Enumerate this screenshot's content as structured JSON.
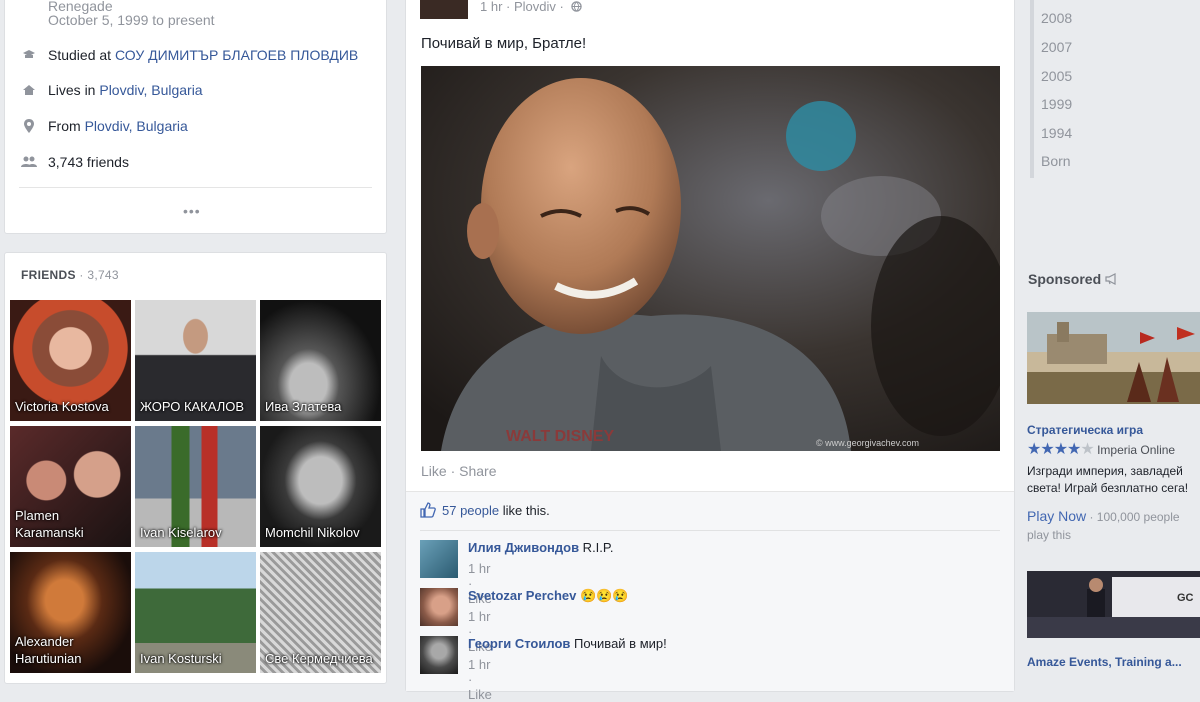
{
  "intro": {
    "top_line": "Renegade",
    "date_line": "October 5, 1999 to present",
    "studied_prefix": "Studied at ",
    "studied_link": "СОУ ДИМИТЪР БЛАГОЕВ ПЛОВДИВ",
    "lives_prefix": "Lives in ",
    "lives_link": "Plovdiv, Bulgaria",
    "from_prefix": "From ",
    "from_link": "Plovdiv, Bulgaria",
    "friends_count": "3,743 friends",
    "more": "•••"
  },
  "friends": {
    "title": "FRIENDS",
    "count": " · 3,743",
    "items": [
      {
        "name": "Victoria Kostova"
      },
      {
        "name": "ЖОРО КАКАЛОВ"
      },
      {
        "name": "Ива Златева"
      },
      {
        "name": "Plamen Karamanski"
      },
      {
        "name": "Ivan Kiselarov"
      },
      {
        "name": "Momchil Nikolov"
      },
      {
        "name": "Alexander Harutiunian"
      },
      {
        "name": "Ivan Kosturski"
      },
      {
        "name": "Све Кермедчиева"
      }
    ]
  },
  "post": {
    "meta": "1 hr · Plovdiv · ",
    "globe_icon": "globe-icon",
    "text": "Почивай в мир, Братле!",
    "photo_print": "WALT DISNEY",
    "photo_watermark": "© www.georgivachev.com",
    "like": "Like",
    "dot": " · ",
    "share": "Share",
    "likes_count": "57 people",
    "likes_suffix": " like this.",
    "comments": [
      {
        "author": "Илия Дживондов",
        "text": " R.I.P.",
        "time": "1 hr",
        "like": "Like"
      },
      {
        "author": "Svetozar Perchev",
        "text": " 😢😢😢",
        "time": "1 hr",
        "like": "Like"
      },
      {
        "author": "Георги Стоилов",
        "text": " Почивай в мир!",
        "time": "1 hr",
        "like": "Like"
      }
    ]
  },
  "timeline_years": [
    "2008",
    "2007",
    "2005",
    "1999",
    "1994",
    "Born"
  ],
  "sponsored": {
    "title": "Sponsored",
    "ads": [
      {
        "title": "Стратегическа игра",
        "rating": 4,
        "source": "Imperia Online",
        "desc1": "Изгради империя, завладей",
        "desc2": "света! Играй безплатно сега!",
        "cta": "Play Now",
        "meta": " · 100,000 people",
        "meta2": "play this"
      },
      {
        "title": "Amaze Events, Training a...",
        "screen_text": "GC"
      }
    ]
  },
  "colors": {
    "page_bg": "#e9ebee",
    "link": "#365899",
    "accent": "#4267b2",
    "muted": "#90949c"
  }
}
